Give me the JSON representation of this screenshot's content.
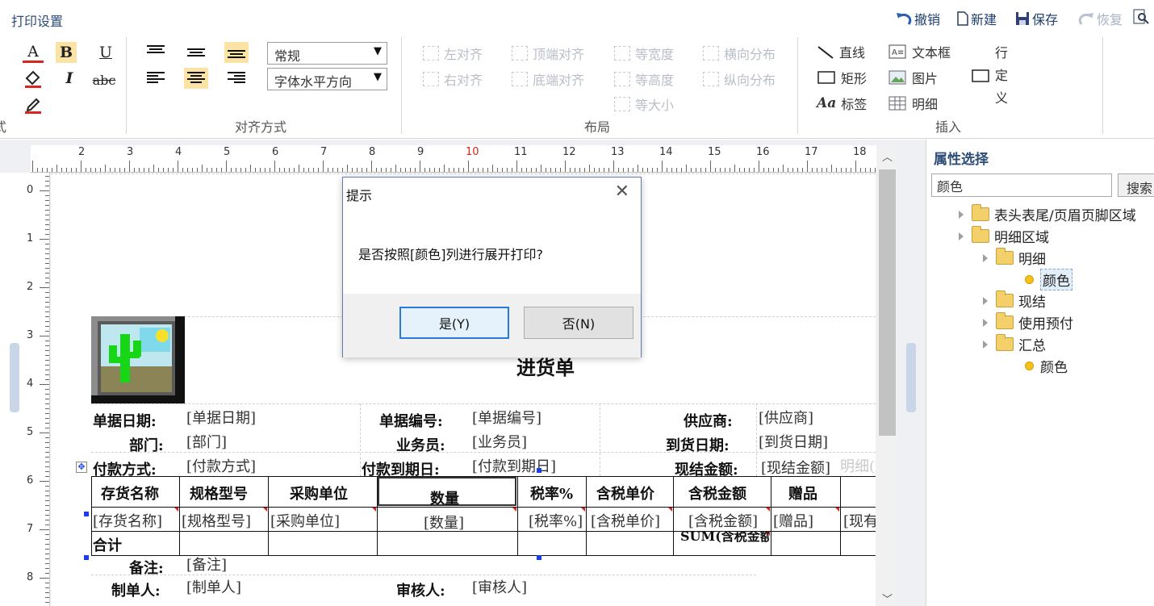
{
  "app": {
    "title": "打印设置"
  },
  "quick_actions": [
    {
      "label": "撤销",
      "icon": "undo-icon",
      "enabled": true
    },
    {
      "label": "新建",
      "icon": "new-doc-icon",
      "enabled": true
    },
    {
      "label": "保存",
      "icon": "save-icon",
      "enabled": true
    },
    {
      "label": "恢复",
      "icon": "redo-icon",
      "enabled": false
    }
  ],
  "ribbon": {
    "groups": {
      "align": "对齐方式",
      "layout": "布局",
      "insert": "插入",
      "partial_left": "式"
    },
    "font_style_select": "常规",
    "font_dir_select": "字体水平方向",
    "layout_buttons": [
      "左对齐",
      "顶端对齐",
      "等宽度",
      "横向分布",
      "右对齐",
      "底端对齐",
      "等高度",
      "纵向分布",
      "等大小"
    ],
    "insert_buttons": [
      "直线",
      "文本框",
      "行定义",
      "矩形",
      "图片",
      "标签",
      "明细"
    ]
  },
  "ruler": {
    "h_numbers": [
      "2",
      "3",
      "4",
      "5",
      "6",
      "7",
      "8",
      "9",
      "10",
      "11",
      "12",
      "13",
      "14",
      "15",
      "16",
      "17",
      "18"
    ],
    "v_numbers": [
      "0",
      "1",
      "2",
      "3",
      "4",
      "5",
      "6",
      "7",
      "8"
    ],
    "highlight": "10"
  },
  "report": {
    "title": "进货单",
    "rows": {
      "r1": [
        "单据日期:",
        "[单据日期]",
        "单据编号:",
        "[单据编号]",
        "供应商:",
        "[供应商]"
      ],
      "r2": [
        "部门:",
        "[部门]",
        "业务员:",
        "[业务员]",
        "到货日期:",
        "[到货日期]"
      ],
      "r3": [
        "付款方式:",
        "[付款方式]",
        "付款到期日:",
        "[付款到期日]",
        "现结金额:",
        "[现结金额]"
      ],
      "ghost": "明细("
    },
    "table_headers": [
      "存货名称",
      "规格型号",
      "采购单位",
      "数量",
      "税率%",
      "含税单价",
      "含税金额",
      "赠品"
    ],
    "table_fields": [
      "[存货名称]",
      "[规格型号]",
      "[采购单位]",
      "[数量]",
      "[税率%]",
      "[含税单价]",
      "[含税金额]",
      "[赠品]",
      "[现有"
    ],
    "total_row": {
      "label": "合计",
      "sum": "SUM(含税金额)"
    },
    "footer_rows": [
      [
        "备注:",
        "[备注]"
      ],
      [
        "制单人:",
        "[制单人]",
        "审核人:",
        "[审核人]"
      ]
    ]
  },
  "properties": {
    "title": "属性选择",
    "search_value": "颜色",
    "search_button": "搜索",
    "tree": [
      {
        "label": "表头表尾/页眉页脚区域",
        "type": "folder",
        "level": 0
      },
      {
        "label": "明细区域",
        "type": "folder",
        "level": 0
      },
      {
        "label": "明细",
        "type": "folder",
        "level": 1
      },
      {
        "label": "颜色",
        "type": "leaf",
        "level": 2,
        "selected": true
      },
      {
        "label": "现结",
        "type": "folder",
        "level": 1
      },
      {
        "label": "使用预付",
        "type": "folder",
        "level": 1
      },
      {
        "label": "汇总",
        "type": "folder",
        "level": 1
      },
      {
        "label": "颜色",
        "type": "leaf",
        "level": 2
      }
    ]
  },
  "dialog": {
    "title": "提示",
    "message": "是否按照[颜色]列进行展开打印?",
    "yes": "是(Y)",
    "no": "否(N)"
  },
  "colors": {
    "accent": "#2a7ad8",
    "title_text": "#2d4e78",
    "ruler_highlight": "#d9251c"
  }
}
